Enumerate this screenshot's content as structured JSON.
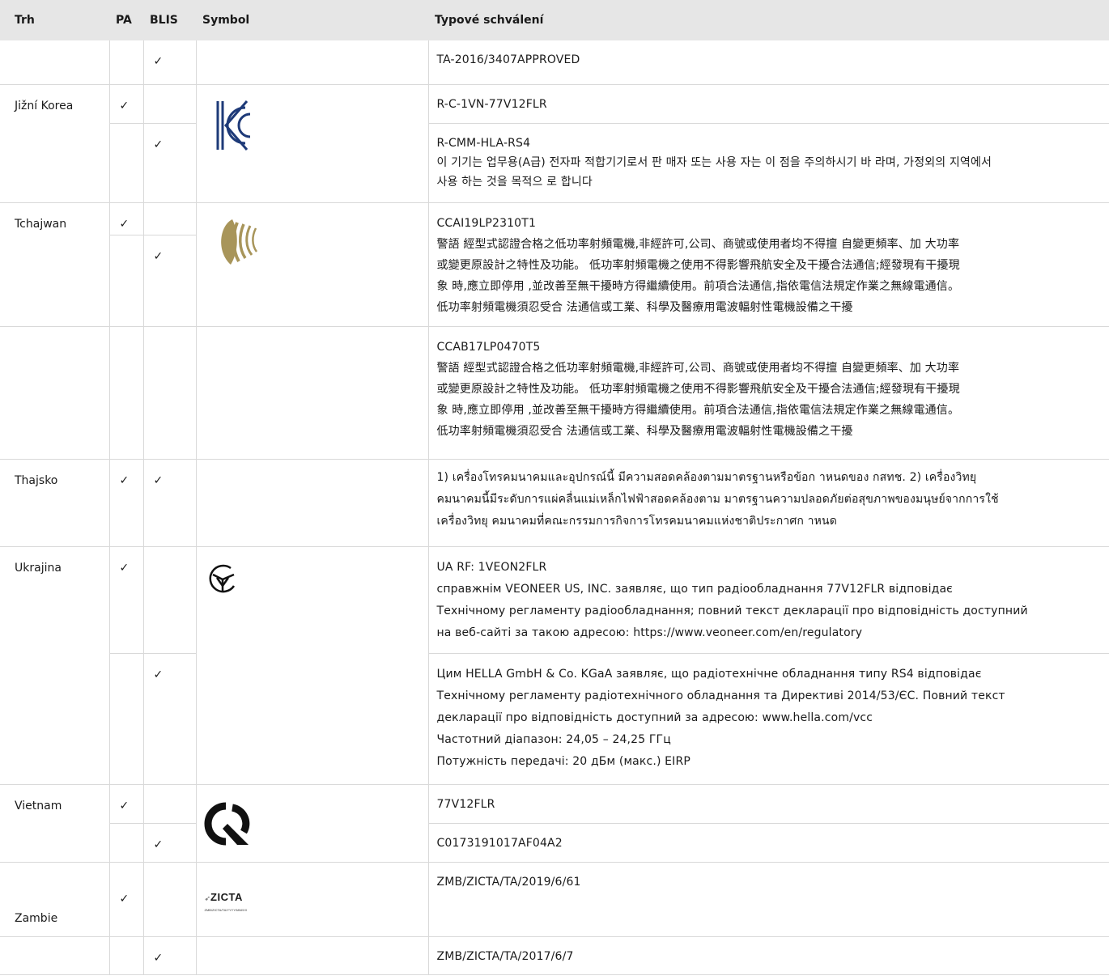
{
  "header": {
    "trh": "Trh",
    "pa": "PA",
    "blis": "BLIS",
    "symbol": "Symbol",
    "approval": "Typové schválení"
  },
  "check": "✓",
  "rows": [
    {
      "market": "",
      "approval": [
        "TA-2016/3407APPROVED"
      ]
    },
    {
      "market": "Jižní Korea",
      "approval": [
        "R-C-1VN-77V12FLR"
      ]
    },
    {
      "market": "",
      "approval": [
        "R-CMM-HLA-RS4",
        "이 기기는 업무용(A급) 전자파 적합기기로서 판 매자 또는 사용 자는 이 점을 주의하시기 바 라며, 가정외의 지역에서",
        "사용 하는 것을 목적으 로 합니다"
      ]
    },
    {
      "market": "Tchajwan",
      "approval": [
        "CCAI19LP2310T1",
        "警語 經型式認證合格之低功率射頻電機,非經許可,公司、商號或使用者均不得擅 自變更頻率、加 大功率",
        "或變更原設計之特性及功能。 低功率射頻電機之使用不得影響飛航安全及干擾合法通信;經發現有干擾現",
        "象 時,應立即停用 ,並改善至無干擾時方得繼續使用。前項合法通信,指依電信法規定作業之無線電通信。",
        "低功率射頻電機須忍受合 法通信或工業、科學及醫療用電波輻射性電機設備之干擾"
      ]
    },
    {
      "market": "",
      "approval": [
        "CCAB17LP0470T5",
        "警語 經型式認證合格之低功率射頻電機,非經許可,公司、商號或使用者均不得擅 自變更頻率、加 大功率",
        "或變更原設計之特性及功能。 低功率射頻電機之使用不得影響飛航安全及干擾合法通信;經發現有干擾現",
        "象 時,應立即停用 ,並改善至無干擾時方得繼續使用。前項合法通信,指依電信法規定作業之無線電通信。",
        "低功率射頻電機須忍受合 法通信或工業、科學及醫療用電波輻射性電機設備之干擾"
      ]
    },
    {
      "market": "Thajsko",
      "approval": [
        "1) เครื่องโทรคมนาคมและอุปกรณ์นี้ มีความสอดคล้องตามมาตรฐานหรือข้อก าหนดของ กสทช. 2) เครื่องวิทยุ",
        "คมนาคมนี้มีระดับการแผ่คลื่นแม่เหล็กไฟฟ้าสอดคล้องตาม มาตรฐานความปลอดภัยต่อสุขภาพของมนุษย์จากการใช้",
        "เครื่องวิทยุ คมนาคมที่คณะกรรมการกิจการโทรคมนาคมแห่งชาติประกาศก าหนด"
      ]
    },
    {
      "market": "Ukrajina",
      "approval": [
        "UA RF: 1VEON2FLR",
        "справжнім VEONEER US, INC. заявляє, що тип радіообладнання 77V12FLR відповідає",
        "Технічному регламенту радіообладнання; повний текст декларації про відповідність доступний",
        "на веб-сайті за такою адресою: https://www.veoneer.com/en/regulatory"
      ]
    },
    {
      "market": "",
      "approval": [
        "Цим HELLA GmbH & Co. KGaA заявляє, що радіотехнічне обладнання типу RS4 відповідає",
        "Технічному регламенту радіотехнічного обладнання та Директиві 2014/53/ЄС. Повний текст",
        "декларації про відповідність доступний за адресою: www.hella.com/vcc",
        "Частотний діапазон: 24,05 – 24,25 ГГц",
        "Потужність передачі: 20 дБм (макс.) EIRP"
      ]
    },
    {
      "market": "Vietnam",
      "approval": [
        "77V12FLR"
      ]
    },
    {
      "market": "",
      "approval": [
        "C0173191017AF04A2"
      ]
    },
    {
      "market": "Zambie",
      "approval": [
        "ZMB/ZICTA/TA/2019/6/61"
      ]
    },
    {
      "market": "",
      "approval": [
        "ZMB/ZICTA/TA/2017/6/7"
      ]
    }
  ],
  "zicta": {
    "name": "ZICTA",
    "sub": "ZMB/ZICTA/TA/YYYY/MM/XX"
  },
  "colors": {
    "header_bg": "#e6e6e6",
    "border": "#d9d9d9",
    "kc_blue": "#1e3a78",
    "taiwan_gold": "#a8955a"
  }
}
